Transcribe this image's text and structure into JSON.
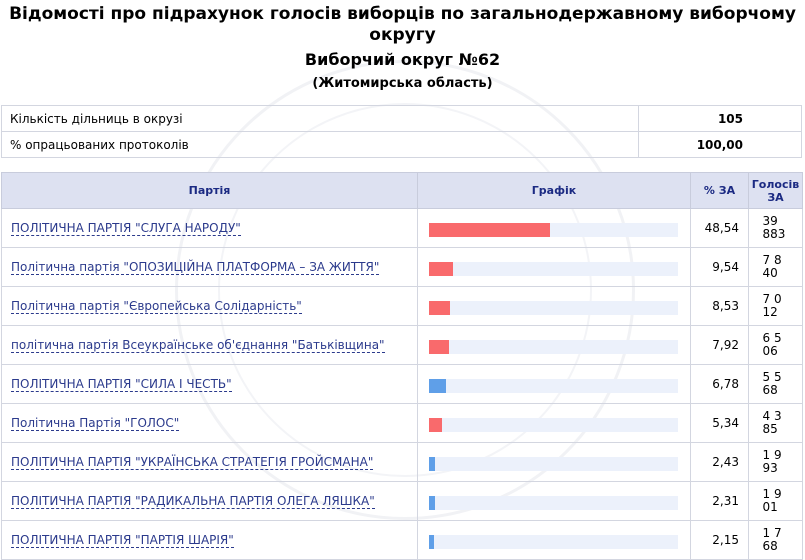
{
  "title": "Відомості про підрахунок голосів виборців по загальнодержавному виборчому округу",
  "district": "Виборчий округ №62",
  "region": "(Житомирська область)",
  "info": [
    {
      "label": "Кількість дільниць в окрузі",
      "value": "105"
    },
    {
      "label": "% опрацьованих протоколів",
      "value": "100,00"
    }
  ],
  "columns": {
    "party": "Партія",
    "graph": "Графік",
    "pct": "% ЗА",
    "votes": "Голосів ЗА"
  },
  "colors": {
    "red": "#f96a6c",
    "blue": "#5f9fe8",
    "track": "#ecf1fb",
    "header_bg": "#dde1f1",
    "link": "#2b3a8c"
  },
  "rows": [
    {
      "party": "ПОЛІТИЧНА ПАРТІЯ \"СЛУГА НАРОДУ\"",
      "pct": "48,54",
      "pct_value": 48.54,
      "votes": "39 883",
      "color": "red"
    },
    {
      "party": "Політична партія \"ОПОЗИЦІЙНА ПЛАТФОРМА – ЗА ЖИТТЯ\"",
      "pct": "9,54",
      "pct_value": 9.54,
      "votes": "7 840",
      "color": "red"
    },
    {
      "party": "Політична партія \"Європейська Солідарність\"",
      "pct": "8,53",
      "pct_value": 8.53,
      "votes": "7 012",
      "color": "red"
    },
    {
      "party": "політична партія Всеукраїнське об'єднання \"Батьківщина\"",
      "pct": "7,92",
      "pct_value": 7.92,
      "votes": "6 506",
      "color": "red"
    },
    {
      "party": "ПОЛІТИЧНА ПАРТІЯ \"СИЛА І ЧЕСТЬ\"",
      "pct": "6,78",
      "pct_value": 6.78,
      "votes": "5 568",
      "color": "blue"
    },
    {
      "party": "Політична Партія \"ГОЛОС\"",
      "pct": "5,34",
      "pct_value": 5.34,
      "votes": "4 385",
      "color": "red"
    },
    {
      "party": "ПОЛІТИЧНА ПАРТІЯ \"УКРАЇНСЬКА СТРАТЕГІЯ ГРОЙСМАНА\"",
      "pct": "2,43",
      "pct_value": 2.43,
      "votes": "1 993",
      "color": "blue"
    },
    {
      "party": "ПОЛІТИЧНА ПАРТІЯ \"РАДИКАЛЬНА ПАРТІЯ ОЛЕГА ЛЯШКА\"",
      "pct": "2,31",
      "pct_value": 2.31,
      "votes": "1 901",
      "color": "blue"
    },
    {
      "party": "ПОЛІТИЧНА ПАРТІЯ \"ПАРТІЯ ШАРІЯ\"",
      "pct": "2,15",
      "pct_value": 2.15,
      "votes": "1 768",
      "color": "blue"
    }
  ]
}
